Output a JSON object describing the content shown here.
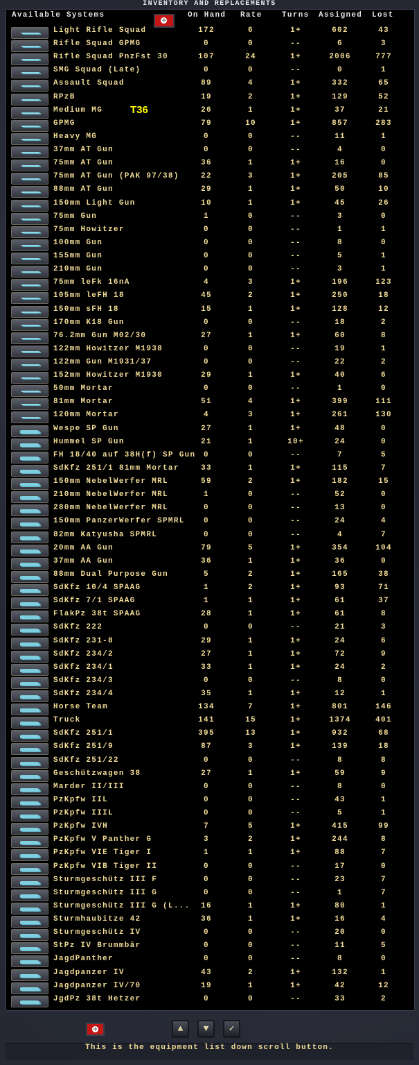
{
  "title": "INVENTORY AND REPLACEMENTS",
  "headers": {
    "systems": "Available Systems",
    "on_hand": "On Hand",
    "rate": "Rate",
    "turns": "Turns",
    "assigned": "Assigned",
    "lost": "Lost"
  },
  "overlay_label": "T36",
  "colors": {
    "text": "#f2dc98",
    "overlay": "#ffff00",
    "flag": "#c41616",
    "icon": "#8fd8e8"
  },
  "rows": [
    [
      "Light Rifle Squad",
      "172",
      "6",
      "1+",
      "602",
      "43"
    ],
    [
      "Rifle Squad GPMG",
      "0",
      "0",
      "--",
      "6",
      "3"
    ],
    [
      "Rifle Squad PnzFst 30",
      "107",
      "24",
      "1+",
      "2006",
      "777"
    ],
    [
      "SMG Squad (Late)",
      "0",
      "0",
      "--",
      "0",
      "1"
    ],
    [
      "Assault Squad",
      "89",
      "4",
      "1+",
      "332",
      "65"
    ],
    [
      "RPzB",
      "19",
      "2",
      "1+",
      "129",
      "52"
    ],
    [
      "Medium MG",
      "26",
      "1",
      "1+",
      "37",
      "21"
    ],
    [
      "GPMG",
      "79",
      "10",
      "1+",
      "857",
      "283"
    ],
    [
      "Heavy MG",
      "0",
      "0",
      "--",
      "11",
      "1"
    ],
    [
      "37mm AT Gun",
      "0",
      "0",
      "--",
      "4",
      "0"
    ],
    [
      "75mm AT Gun",
      "36",
      "1",
      "1+",
      "16",
      "0"
    ],
    [
      "75mm AT Gun (PAK 97/38)",
      "22",
      "3",
      "1+",
      "205",
      "85"
    ],
    [
      "88mm AT Gun",
      "29",
      "1",
      "1+",
      "50",
      "10"
    ],
    [
      "150mm Light Gun",
      "10",
      "1",
      "1+",
      "45",
      "26"
    ],
    [
      "75mm Gun",
      "1",
      "0",
      "--",
      "3",
      "0"
    ],
    [
      "75mm Howitzer",
      "0",
      "0",
      "--",
      "1",
      "1"
    ],
    [
      "100mm Gun",
      "0",
      "0",
      "--",
      "8",
      "0"
    ],
    [
      "155mm Gun",
      "0",
      "0",
      "--",
      "5",
      "1"
    ],
    [
      "210mm Gun",
      "0",
      "0",
      "--",
      "3",
      "1"
    ],
    [
      "75mm leFk 16nA",
      "4",
      "3",
      "1+",
      "196",
      "123"
    ],
    [
      "105mm leFH 18",
      "45",
      "2",
      "1+",
      "250",
      "18"
    ],
    [
      "150mm sFH 18",
      "15",
      "1",
      "1+",
      "128",
      "12"
    ],
    [
      "170mm K18 Gun",
      "0",
      "0",
      "--",
      "18",
      "2"
    ],
    [
      "76.2mm Gun M02/30",
      "27",
      "1",
      "1+",
      "60",
      "8"
    ],
    [
      "122mm Howitzer M1938",
      "0",
      "0",
      "--",
      "19",
      "1"
    ],
    [
      "122mm Gun M1931/37",
      "0",
      "0",
      "--",
      "22",
      "2"
    ],
    [
      "152mm Howitzer M1930",
      "29",
      "1",
      "1+",
      "40",
      "6"
    ],
    [
      "50mm Mortar",
      "0",
      "0",
      "--",
      "1",
      "0"
    ],
    [
      "81mm Mortar",
      "51",
      "4",
      "1+",
      "399",
      "111"
    ],
    [
      "120mm Mortar",
      "4",
      "3",
      "1+",
      "261",
      "130"
    ],
    [
      "Wespe SP Gun",
      "27",
      "1",
      "1+",
      "48",
      "0"
    ],
    [
      "Hummel SP Gun",
      "21",
      "1",
      "10+",
      "24",
      "0"
    ],
    [
      "FH 18/40 auf 38H(f) SP Gun",
      "0",
      "0",
      "--",
      "7",
      "5"
    ],
    [
      "SdKfz 251/1 81mm Mortar",
      "33",
      "1",
      "1+",
      "115",
      "7"
    ],
    [
      "150mm NebelWerfer MRL",
      "59",
      "2",
      "1+",
      "182",
      "15"
    ],
    [
      "210mm NebelWerfer MRL",
      "1",
      "0",
      "--",
      "52",
      "0"
    ],
    [
      "280mm NebelWerfer MRL",
      "0",
      "0",
      "--",
      "13",
      "0"
    ],
    [
      "150mm PanzerWerfer SPMRL",
      "0",
      "0",
      "--",
      "24",
      "4"
    ],
    [
      "82mm Katyusha SPMRL",
      "0",
      "0",
      "--",
      "4",
      "7"
    ],
    [
      "20mm AA Gun",
      "79",
      "5",
      "1+",
      "354",
      "104"
    ],
    [
      "37mm AA Gun",
      "36",
      "1",
      "1+",
      "36",
      "0"
    ],
    [
      "88mm Dual Purpose Gun",
      "5",
      "2",
      "1+",
      "165",
      "38"
    ],
    [
      "SdKfz 10/4 SPAAG",
      "1",
      "2",
      "1+",
      "93",
      "71"
    ],
    [
      "SdKfz 7/1 SPAAG",
      "1",
      "1",
      "1+",
      "61",
      "37"
    ],
    [
      "FlakPz 38t SPAAG",
      "28",
      "1",
      "1+",
      "61",
      "8"
    ],
    [
      "SdKfz 222",
      "0",
      "0",
      "--",
      "21",
      "3"
    ],
    [
      "SdKfz 231-8",
      "29",
      "1",
      "1+",
      "24",
      "6"
    ],
    [
      "SdKfz 234/2",
      "27",
      "1",
      "1+",
      "72",
      "9"
    ],
    [
      "SdKfz 234/1",
      "33",
      "1",
      "1+",
      "24",
      "2"
    ],
    [
      "SdKfz 234/3",
      "0",
      "0",
      "--",
      "8",
      "0"
    ],
    [
      "SdKfz 234/4",
      "35",
      "1",
      "1+",
      "12",
      "1"
    ],
    [
      "Horse Team",
      "134",
      "7",
      "1+",
      "801",
      "146"
    ],
    [
      "Truck",
      "141",
      "15",
      "1+",
      "1374",
      "401"
    ],
    [
      "SdKfz 251/1",
      "395",
      "13",
      "1+",
      "932",
      "68"
    ],
    [
      "SdKfz 251/9",
      "87",
      "3",
      "1+",
      "139",
      "18"
    ],
    [
      "SdKfz 251/22",
      "0",
      "0",
      "--",
      "8",
      "8"
    ],
    [
      "Geschützwagen 38",
      "27",
      "1",
      "1+",
      "59",
      "9"
    ],
    [
      "Marder II/III",
      "0",
      "0",
      "--",
      "8",
      "0"
    ],
    [
      "PzKpfw IIL",
      "0",
      "0",
      "--",
      "43",
      "1"
    ],
    [
      "PzKpfw IIIL",
      "0",
      "0",
      "--",
      "5",
      "1"
    ],
    [
      "PzKpfw IVH",
      "7",
      "5",
      "1+",
      "415",
      "99"
    ],
    [
      "PzKpfw V Panther G",
      "3",
      "2",
      "1+",
      "244",
      "8"
    ],
    [
      "PzKpfw VIE Tiger I",
      "1",
      "1",
      "1+",
      "88",
      "7"
    ],
    [
      "PzKpfw VIB Tiger II",
      "0",
      "0",
      "--",
      "17",
      "0"
    ],
    [
      "Sturmgeschütz III F",
      "0",
      "0",
      "--",
      "23",
      "7"
    ],
    [
      "Sturmgeschütz III G",
      "0",
      "0",
      "--",
      "1",
      "7"
    ],
    [
      "Sturmgeschütz III G (L...",
      "16",
      "1",
      "1+",
      "80",
      "1"
    ],
    [
      "Sturmhaubitze 42",
      "36",
      "1",
      "1+",
      "16",
      "4"
    ],
    [
      "Sturmgeschütz IV",
      "0",
      "0",
      "--",
      "20",
      "0"
    ],
    [
      "StPz IV Brummbär",
      "0",
      "0",
      "--",
      "11",
      "5"
    ],
    [
      "JagdPanther",
      "0",
      "0",
      "--",
      "8",
      "0"
    ],
    [
      "Jagdpanzer IV",
      "43",
      "2",
      "1+",
      "132",
      "1"
    ],
    [
      "Jagdpanzer IV/70",
      "19",
      "1",
      "1+",
      "42",
      "12"
    ],
    [
      "JgdPz 38t Hetzer",
      "0",
      "0",
      "--",
      "33",
      "2"
    ]
  ],
  "controls": {
    "scroll_up": "▲",
    "scroll_down": "▼",
    "confirm": "✓"
  },
  "status_text": "This is the equipment list down scroll button."
}
